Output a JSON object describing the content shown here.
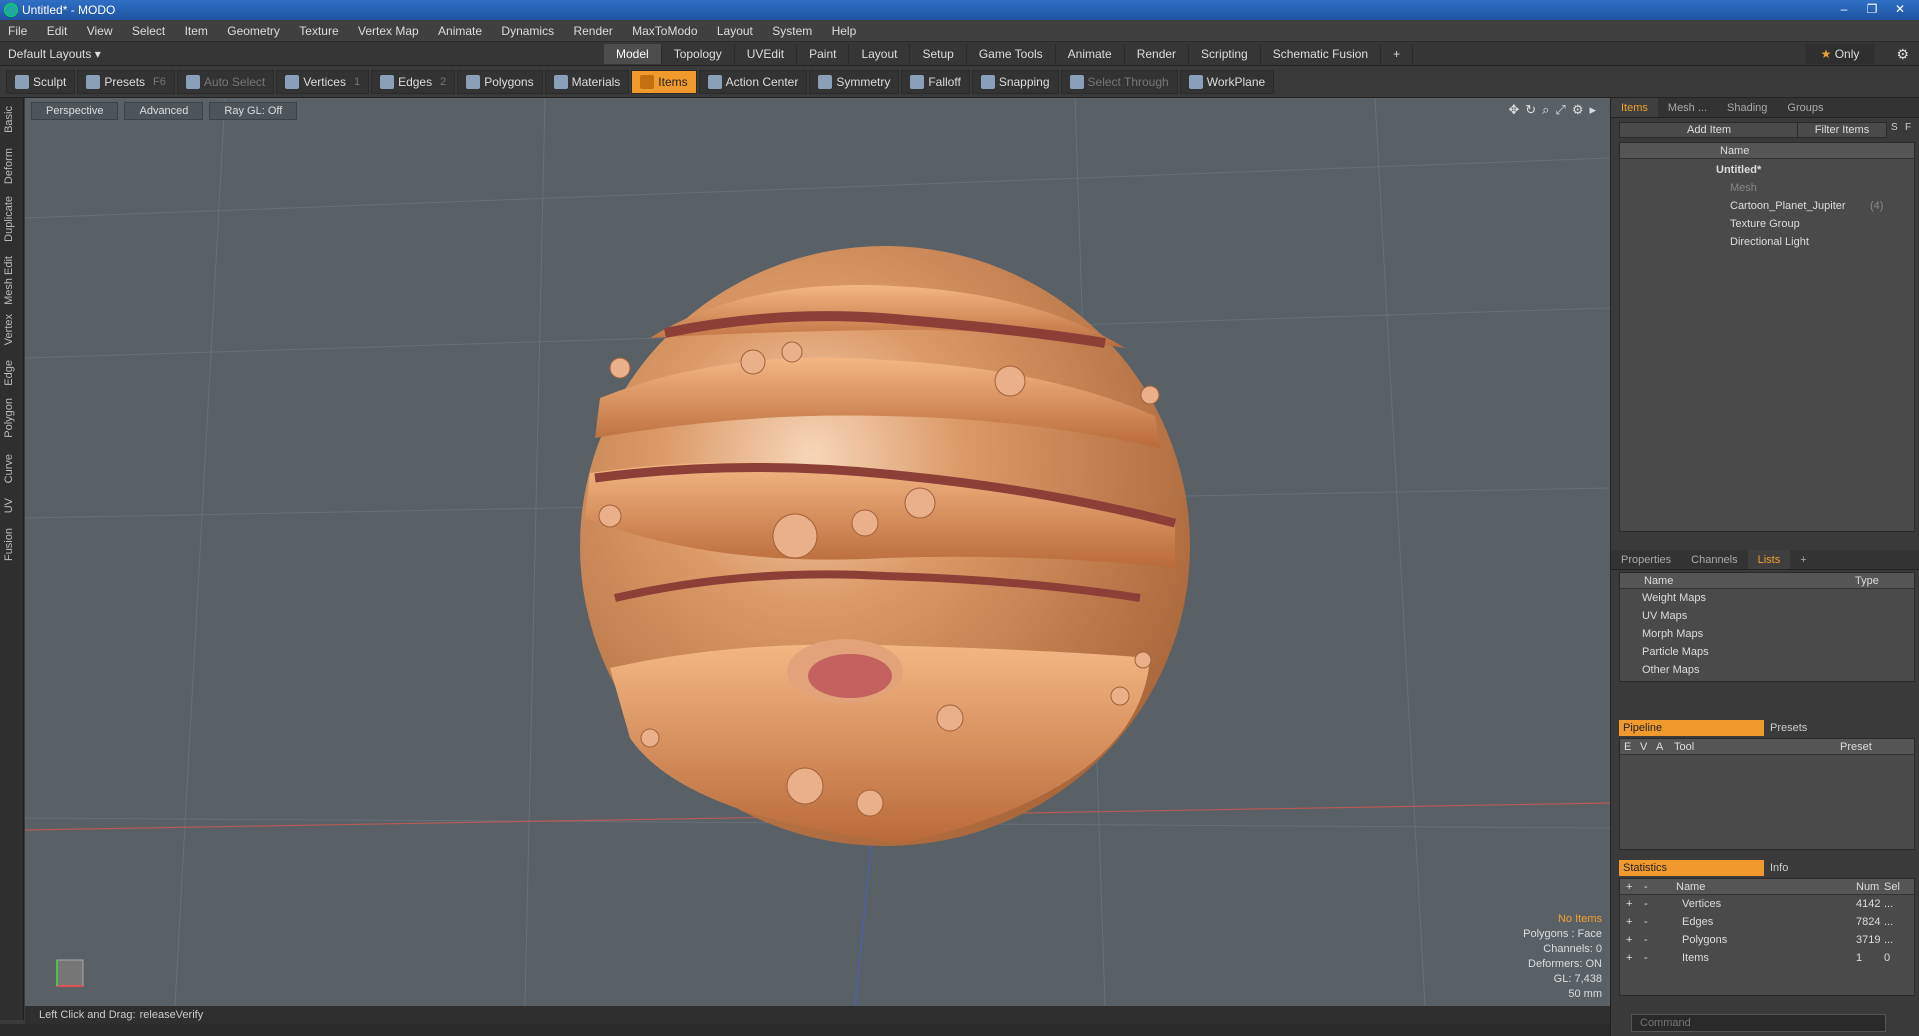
{
  "window": {
    "title": "Untitled* - MODO",
    "controls": [
      "–",
      "❐",
      "✕"
    ]
  },
  "menu": [
    "File",
    "Edit",
    "View",
    "Select",
    "Item",
    "Geometry",
    "Texture",
    "Vertex Map",
    "Animate",
    "Dynamics",
    "Render",
    "MaxToModo",
    "Layout",
    "System",
    "Help"
  ],
  "layout_selector": "Default Layouts ▾",
  "mode_tabs": [
    "Model",
    "Topology",
    "UVEdit",
    "Paint",
    "Layout",
    "Setup",
    "Game Tools",
    "Animate",
    "Render",
    "Scripting",
    "Schematic Fusion",
    "+"
  ],
  "only_button": {
    "star": "★",
    "label": "Only"
  },
  "toolbar": {
    "sculpt": "Sculpt",
    "presets": "Presets",
    "presets_key": "F6",
    "auto_select": "Auto Select",
    "vertices": "Vertices",
    "vertices_key": "1",
    "edges": "Edges",
    "edges_key": "2",
    "polygons": "Polygons",
    "materials": "Materials",
    "items": "Items",
    "action_center": "Action Center",
    "symmetry": "Symmetry",
    "falloff": "Falloff",
    "snapping": "Snapping",
    "select_through": "Select Through",
    "workplane": "WorkPlane"
  },
  "left_tabs": [
    "Basic",
    "Deform",
    "Duplicate",
    "Mesh Edit",
    "Vertex",
    "Edge",
    "Polygon",
    "Curve",
    "UV",
    "Fusion"
  ],
  "viewport": {
    "buttons": [
      "Perspective",
      "Advanced",
      "Ray GL: Off"
    ],
    "stats": {
      "no_items": "No Items",
      "polygons": "Polygons : Face",
      "channels": "Channels: 0",
      "deformers": "Deformers: ON",
      "gl": "GL: 7,438",
      "size": "50 mm"
    }
  },
  "status": {
    "label": "Left Click and Drag:",
    "message": "releaseVerify"
  },
  "items_panel": {
    "tabs": [
      "Items",
      "Mesh ...",
      "Shading",
      "Groups"
    ],
    "add_item": "Add Item",
    "filter": "Filter Items",
    "s": "S",
    "f": "F",
    "col_name": "Name",
    "tree": [
      {
        "label": "Untitled*",
        "count": ""
      },
      {
        "label": "Mesh",
        "count": ""
      },
      {
        "label": "Cartoon_Planet_Jupiter",
        "count": "(4)"
      },
      {
        "label": "Texture Group",
        "count": ""
      },
      {
        "label": "Directional Light",
        "count": ""
      }
    ]
  },
  "lists_panel": {
    "tabs": [
      "Properties",
      "Channels",
      "Lists",
      "+"
    ],
    "col_name": "Name",
    "col_type": "Type",
    "rows": [
      "Weight Maps",
      "UV Maps",
      "Morph Maps",
      "Particle Maps",
      "Other Maps"
    ]
  },
  "pipeline": {
    "tab_pipeline": "Pipeline",
    "tab_presets": "Presets",
    "cols": [
      "E",
      "V",
      "A",
      "Tool",
      "Preset"
    ]
  },
  "statistics": {
    "tab_stats": "Statistics",
    "tab_info": "Info",
    "cols": [
      "+",
      "-",
      "Name",
      "Num",
      "Sel"
    ],
    "rows": [
      {
        "name": "Vertices",
        "num": "4142",
        "sel": "..."
      },
      {
        "name": "Edges",
        "num": "7824",
        "sel": "..."
      },
      {
        "name": "Polygons",
        "num": "3719",
        "sel": "..."
      },
      {
        "name": "Items",
        "num": "1",
        "sel": "0"
      }
    ]
  },
  "command": {
    "placeholder": "Command"
  },
  "colors": {
    "accent": "#f09a2e",
    "viewport_bg": "#596167",
    "planet": "#d58a55"
  }
}
